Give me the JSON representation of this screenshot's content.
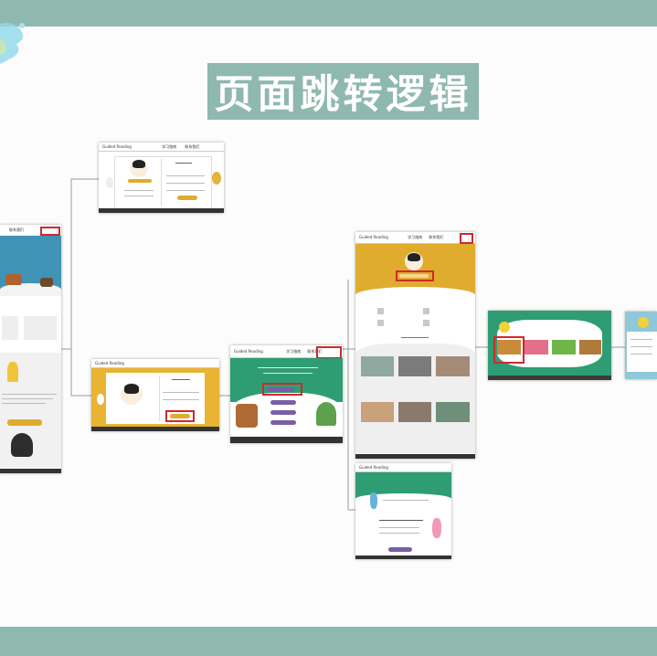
{
  "page_title": "页面跳转逻辑",
  "colors": {
    "band": "#8fb8ae",
    "highlight": "#d0282e",
    "accent_yellow": "#e0ac2e",
    "accent_green": "#2e9d74",
    "accent_purple": "#7a5ea7"
  },
  "nav_brand": "Guided Reading",
  "nav_items": [
    "学习指南",
    "联系我们"
  ]
}
